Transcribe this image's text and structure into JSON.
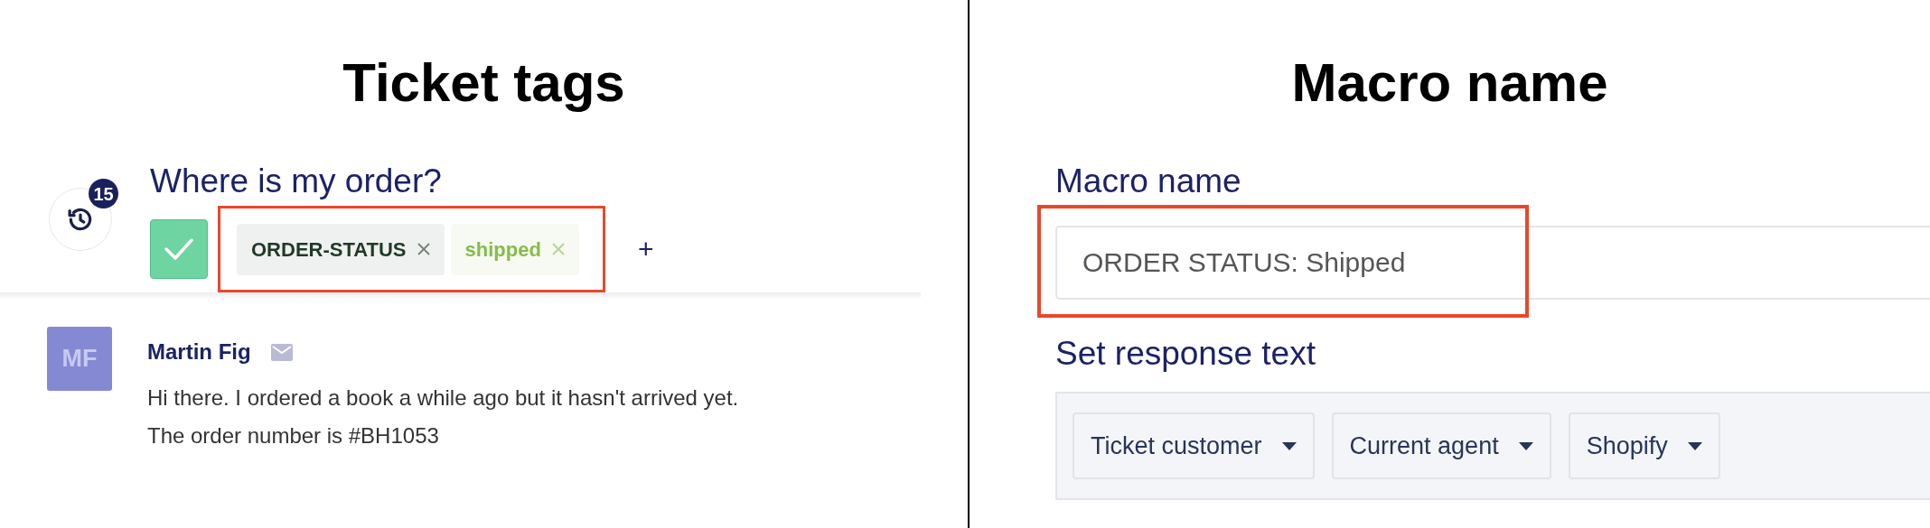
{
  "ticket_tags": {
    "heading": "Ticket tags",
    "history_badge": "15",
    "ticket_title": "Where is my order?",
    "tags_highlighted": true,
    "tags": [
      {
        "label": "ORDER-STATUS",
        "color": "#1f3a26"
      },
      {
        "label": "shipped",
        "color": "#86bc4c"
      }
    ],
    "add_tag": "+",
    "message": {
      "avatar": "MF",
      "sender": "Martin Fig",
      "body": "Hi there. I ordered a book a while ago but it hasn't arrived yet.\nThe order number is #BH1053"
    }
  },
  "macro_name": {
    "heading": "Macro name",
    "field_label": "Macro name",
    "value": "ORDER STATUS: Shipped",
    "field_highlighted": true,
    "section_label": "Set response text",
    "variable_buttons": [
      "Ticket customer",
      "Current agent",
      "Shopify"
    ]
  }
}
